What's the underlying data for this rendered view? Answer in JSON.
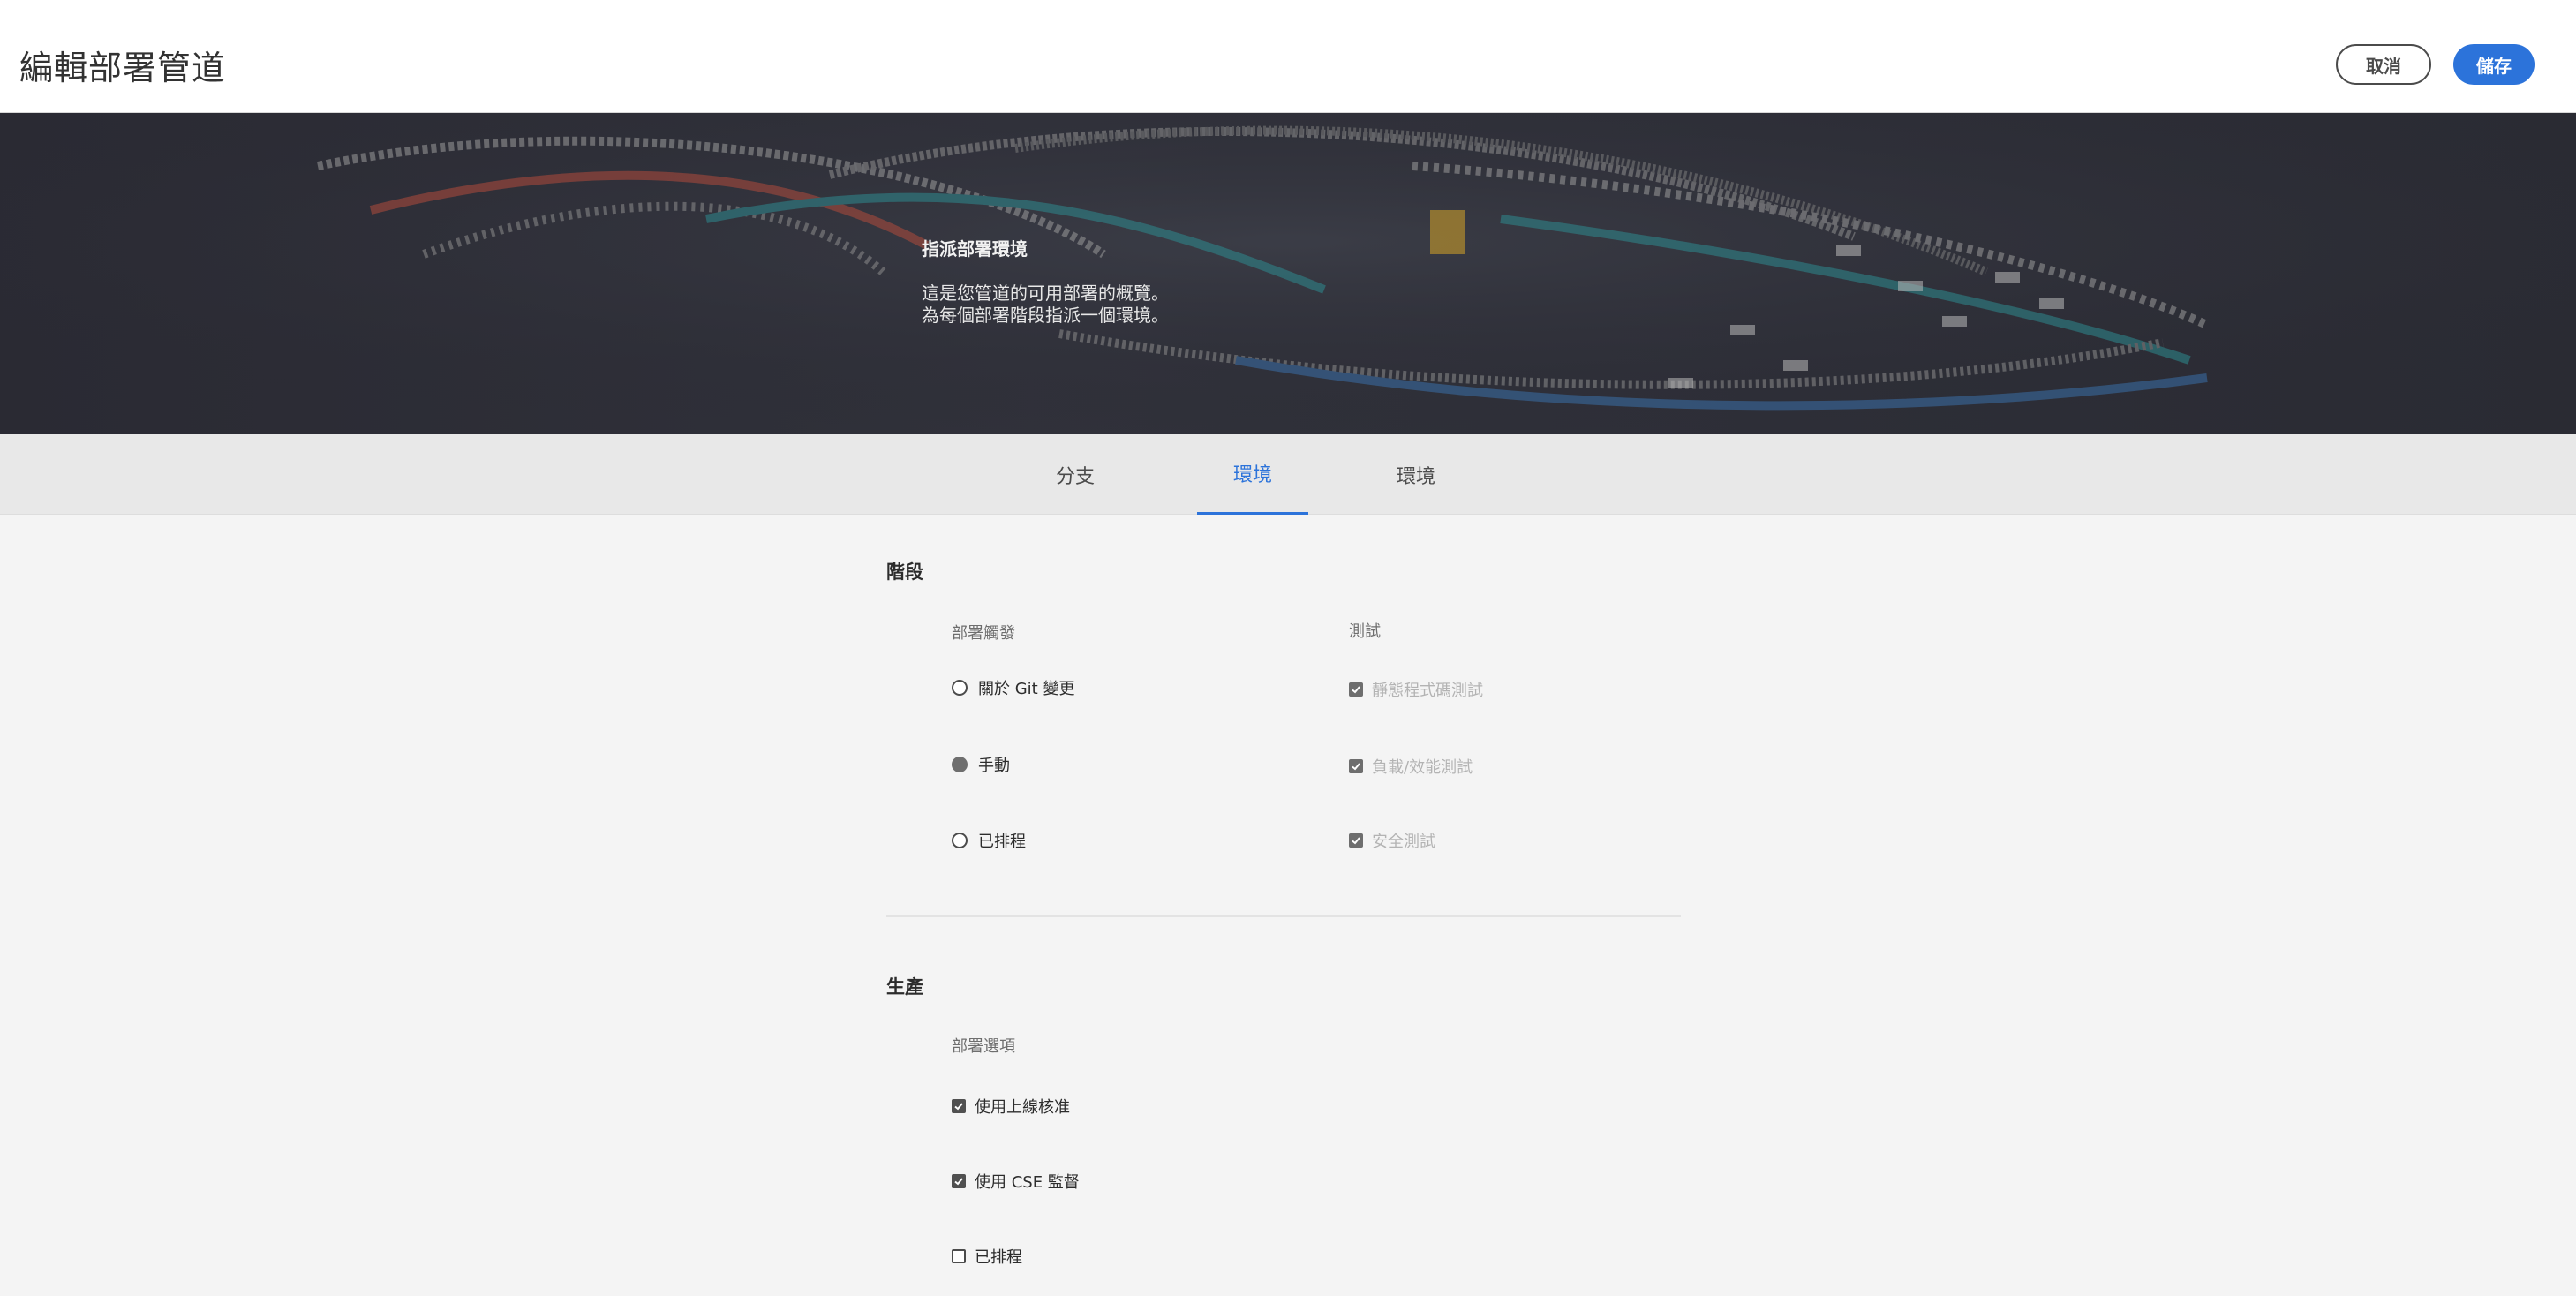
{
  "header": {
    "title": "編輯部署管道",
    "cancel_label": "取消",
    "save_label": "儲存"
  },
  "hero": {
    "title": "指派部署環境",
    "line1": "這是您管道的可用部署的概覽。",
    "line2": "為每個部署階段指派一個環境。"
  },
  "tabs": [
    {
      "label": "分支",
      "active": false
    },
    {
      "label": "環境",
      "active": true
    },
    {
      "label": "環境",
      "active": false
    }
  ],
  "stage": {
    "title": "階段",
    "trigger_label": "部署觸發",
    "triggers": [
      {
        "label": "關於 Git 變更",
        "selected": false
      },
      {
        "label": "手動",
        "selected": true
      },
      {
        "label": "已排程",
        "selected": false
      }
    ],
    "tests_label": "測試",
    "tests": [
      {
        "label": "靜態程式碼測試",
        "checked": true,
        "disabled": true
      },
      {
        "label": "負載/效能測試",
        "checked": true,
        "disabled": true
      },
      {
        "label": "安全測試",
        "checked": true,
        "disabled": true
      }
    ]
  },
  "production": {
    "title": "生產",
    "options_label": "部署選項",
    "options": [
      {
        "label": "使用上線核准",
        "checked": true
      },
      {
        "label": "使用 CSE 監督",
        "checked": true
      },
      {
        "label": "已排程",
        "checked": false
      }
    ]
  },
  "colors": {
    "accent": "#2c73da",
    "hero_bg": "#2d2e37"
  }
}
